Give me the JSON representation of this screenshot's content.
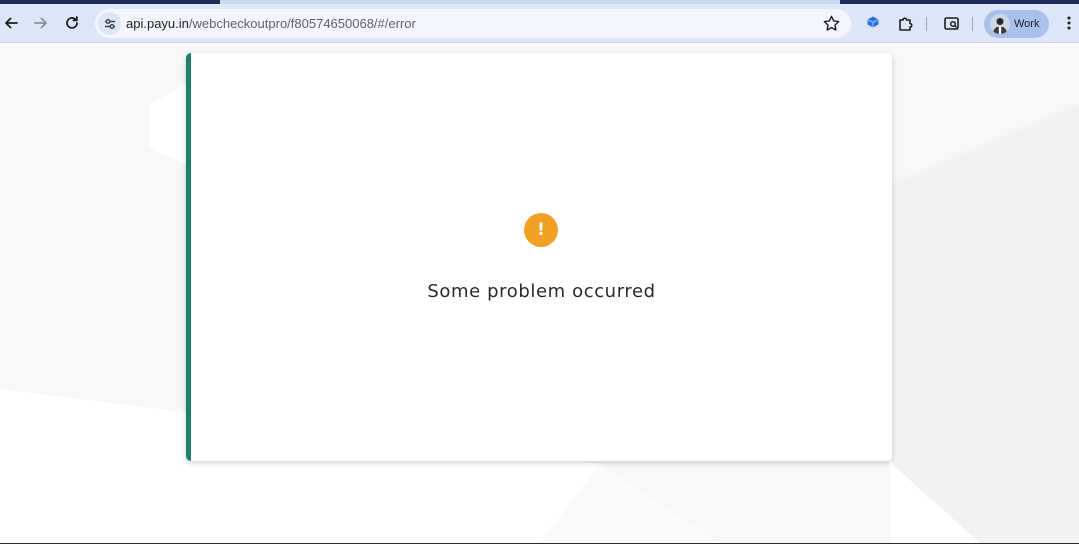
{
  "browser": {
    "back_icon": "arrow-left-icon",
    "forward_icon": "arrow-right-icon",
    "reload_icon": "reload-icon",
    "site_info_icon": "tune-icon",
    "address": {
      "host": "api.payu.in",
      "path": "/webcheckoutpro/f80574650068/#/error"
    },
    "bookmark_icon": "star-icon",
    "extension_icons": [
      "extension-cube-icon",
      "puzzle-icon"
    ],
    "tab_search_icon": "tab-search-icon",
    "profile": {
      "label": "Work",
      "avatar_icon": "profile-avatar"
    },
    "menu_icon": "more-vert-icon"
  },
  "error_card": {
    "icon": "warning-icon",
    "icon_glyph": "!",
    "message": "Some problem occurred",
    "colors": {
      "accent_bar": "#1f7f6a",
      "warning": "#f2a024"
    }
  }
}
